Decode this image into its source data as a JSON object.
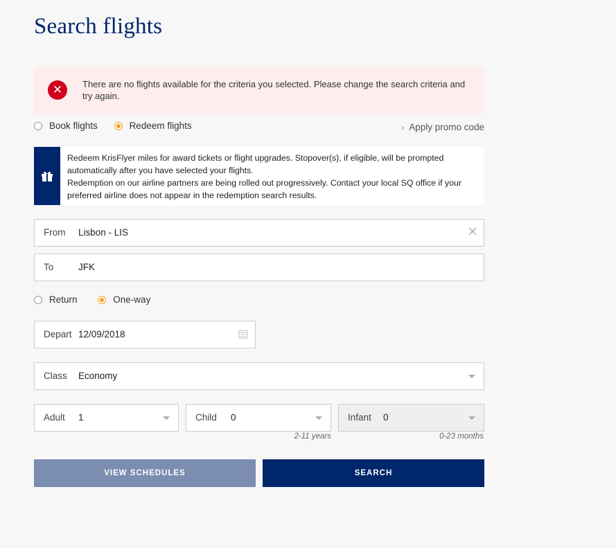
{
  "page": {
    "title": "Search flights"
  },
  "error": {
    "message": "There are no flights available for the criteria you selected. Please change the search criteria and try again."
  },
  "mode": {
    "options": [
      {
        "label": "Book flights",
        "checked": false
      },
      {
        "label": "Redeem flights",
        "checked": true
      }
    ],
    "promo_label": "Apply promo code"
  },
  "info": {
    "text": "Redeem KrisFlyer miles for award tickets or flight upgrades. Stopover(s), if eligible, will be prompted automatically after you have selected your flights.\nRedemption on our airline partners are being rolled out progressively. Contact your local SQ office if your preferred airline does not appear in the redemption search results.",
    "icon": "gift-icon"
  },
  "route": {
    "from_label": "From",
    "from_value": "Lisbon - LIS",
    "to_label": "To",
    "to_value": "JFK"
  },
  "trip_type": {
    "options": [
      {
        "label": "Return",
        "checked": false
      },
      {
        "label": "One-way",
        "checked": true
      }
    ]
  },
  "depart": {
    "label": "Depart",
    "value": "12/09/2018"
  },
  "cabin": {
    "label": "Class",
    "value": "Economy"
  },
  "passengers": {
    "adult": {
      "label": "Adult",
      "value": "1"
    },
    "child": {
      "label": "Child",
      "value": "0",
      "hint": "2-11 years"
    },
    "infant": {
      "label": "Infant",
      "value": "0",
      "hint": "0-23 months"
    }
  },
  "buttons": {
    "view_schedules": "VIEW SCHEDULES",
    "search": "SEARCH"
  },
  "colors": {
    "brand_navy": "#00266b",
    "accent_orange": "#f99f1b",
    "error_red": "#d0021b",
    "secondary_button": "#7b8db0"
  }
}
